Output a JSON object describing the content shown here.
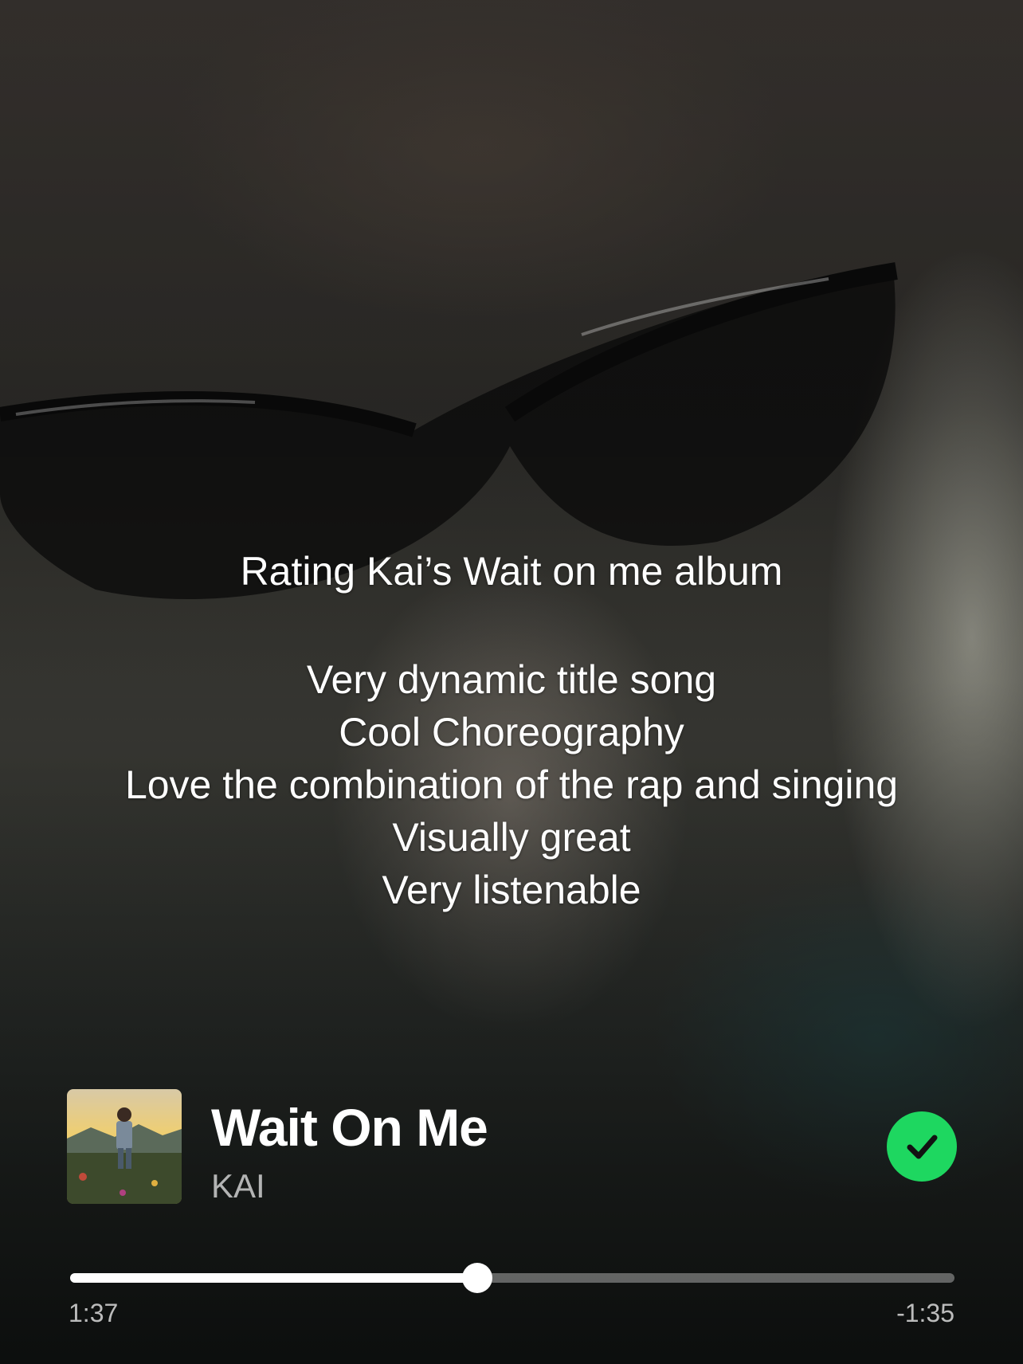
{
  "caption": {
    "title": "Rating Kai’s Wait on me album",
    "lines": [
      "Very dynamic title song",
      "Cool Choreography",
      "Love the combination of the rap and singing",
      "Visually great",
      "Very listenable"
    ]
  },
  "now_playing": {
    "track_title": "Wait On Me",
    "artist": "KAI",
    "saved": true,
    "saved_icon": "check-icon",
    "accent_color": "#1ed760",
    "elapsed": "1:37",
    "remaining": "-1:35",
    "progress_fraction": 0.46
  }
}
